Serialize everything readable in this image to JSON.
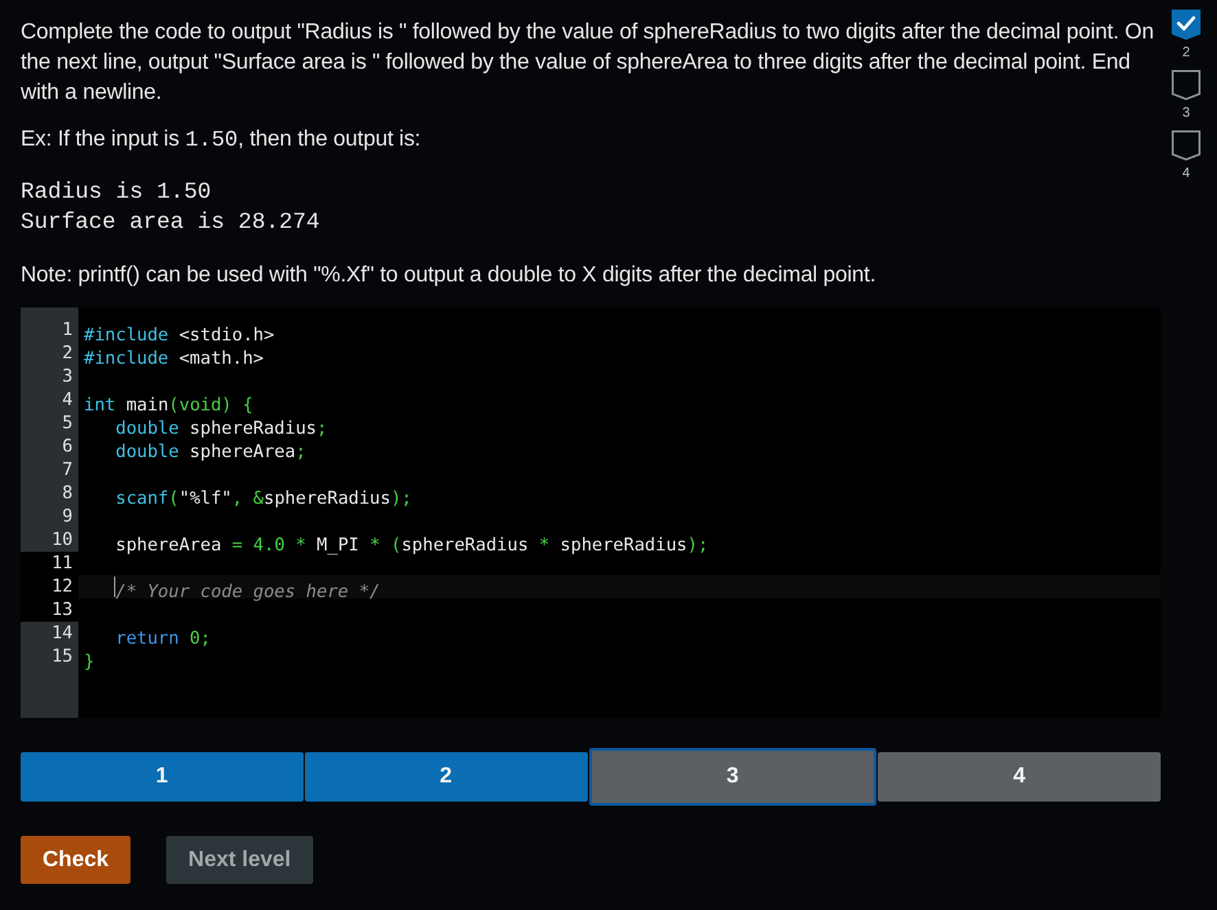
{
  "instructions": "Complete the code to output \"Radius is \" followed by the value of sphereRadius to two digits after the decimal point. On the next line, output \"Surface area is \" followed by the value of sphereArea to three digits after the decimal point. End with a newline.",
  "example": [
    {
      "kind": "text",
      "text": "Ex: If the input is "
    },
    {
      "kind": "code",
      "text": "1.50"
    },
    {
      "kind": "text",
      "text": ", then the output is:"
    }
  ],
  "expected_output": [
    "Radius is 1.50",
    "Surface area is 28.274"
  ],
  "note": "Note: printf() can be used with \"%.Xf\" to output a double to X digits after the decimal point.",
  "editor": {
    "lines": [
      {
        "number": "1",
        "editable": false,
        "active": false,
        "tokens": [
          {
            "kind": "keyword",
            "text": "#include"
          },
          {
            "kind": "plain",
            "text": " <stdio.h>"
          }
        ]
      },
      {
        "number": "2",
        "editable": false,
        "active": false,
        "tokens": [
          {
            "kind": "keyword",
            "text": "#include"
          },
          {
            "kind": "plain",
            "text": " <math.h>"
          }
        ]
      },
      {
        "number": "3",
        "editable": false,
        "active": false
      },
      {
        "number": "4",
        "editable": false,
        "active": false,
        "tokens": [
          {
            "kind": "keyword",
            "text": "int"
          },
          {
            "kind": "plain",
            "text": " main"
          },
          {
            "kind": "punct",
            "text": "(void) {"
          }
        ]
      },
      {
        "number": "5",
        "editable": false,
        "active": false,
        "tokens": [
          {
            "kind": "keyword",
            "text": "   double"
          },
          {
            "kind": "plain",
            "text": " sphereRadius"
          },
          {
            "kind": "punct",
            "text": ";"
          }
        ]
      },
      {
        "number": "6",
        "editable": false,
        "active": false,
        "tokens": [
          {
            "kind": "keyword",
            "text": "   double"
          },
          {
            "kind": "plain",
            "text": " sphereArea"
          },
          {
            "kind": "punct",
            "text": ";"
          }
        ]
      },
      {
        "number": "7",
        "editable": false,
        "active": false
      },
      {
        "number": "8",
        "editable": false,
        "active": false,
        "tokens": [
          {
            "kind": "keyword",
            "text": "   scanf"
          },
          {
            "kind": "punct",
            "text": "("
          },
          {
            "kind": "plain",
            "text": "\"%lf\""
          },
          {
            "kind": "punct",
            "text": ", &"
          },
          {
            "kind": "plain",
            "text": "sphereRadius"
          },
          {
            "kind": "punct",
            "text": ");"
          }
        ]
      },
      {
        "number": "9",
        "editable": false,
        "active": false
      },
      {
        "number": "10",
        "editable": false,
        "active": false,
        "tokens": [
          {
            "kind": "plain",
            "text": "   sphereArea"
          },
          {
            "kind": "punct",
            "text": " = "
          },
          {
            "kind": "number",
            "text": "4.0"
          },
          {
            "kind": "punct",
            "text": " * "
          },
          {
            "kind": "plain",
            "text": "M_PI"
          },
          {
            "kind": "punct",
            "text": " * ("
          },
          {
            "kind": "plain",
            "text": "sphereRadius"
          },
          {
            "kind": "punct",
            "text": " * "
          },
          {
            "kind": "plain",
            "text": "sphereRadius"
          },
          {
            "kind": "punct",
            "text": ");"
          }
        ]
      },
      {
        "number": "11",
        "editable": true,
        "active": false
      },
      {
        "number": "12",
        "editable": true,
        "active": true,
        "tokens": [
          {
            "kind": "comment",
            "text": "   /* Your code goes here */"
          }
        ]
      },
      {
        "number": "13",
        "editable": true,
        "active": false
      },
      {
        "number": "14",
        "editable": false,
        "active": false,
        "tokens": [
          {
            "kind": "control",
            "text": "   return"
          },
          {
            "kind": "number",
            "text": " 0"
          },
          {
            "kind": "punct",
            "text": ";"
          }
        ]
      },
      {
        "number": "15",
        "editable": false,
        "active": false,
        "tokens": [
          {
            "kind": "punct",
            "text": "}"
          }
        ]
      }
    ]
  },
  "progress": [
    {
      "label": "1",
      "completed": true,
      "selected": false
    },
    {
      "label": "2",
      "completed": true,
      "selected": false
    },
    {
      "label": "3",
      "completed": false,
      "selected": true
    },
    {
      "label": "4",
      "completed": false,
      "selected": false
    }
  ],
  "buttons": [
    {
      "kind": "primary",
      "label": "Check",
      "disabled": false
    },
    {
      "kind": "secondary",
      "label": "Next level",
      "disabled": true
    }
  ],
  "level_tracker": [
    {
      "kind": "badge",
      "checked": true
    },
    {
      "kind": "label",
      "text": "2"
    },
    {
      "kind": "badge",
      "checked": false
    },
    {
      "kind": "label",
      "text": "3"
    },
    {
      "kind": "badge",
      "checked": false
    },
    {
      "kind": "label",
      "text": "4"
    }
  ]
}
